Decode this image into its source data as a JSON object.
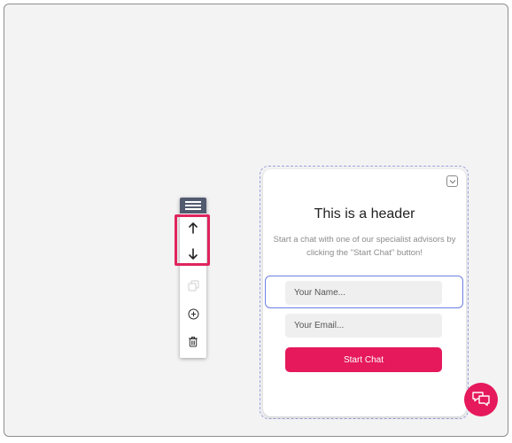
{
  "toolbar": {
    "icons": [
      "drag-handle-icon",
      "arrow-up-icon",
      "arrow-down-icon",
      "copy-icon",
      "add-circle-icon",
      "trash-icon"
    ]
  },
  "widget": {
    "header": "This is a header",
    "subtext": "Start a chat with one of our specialist advisors by clicking the \"Start Chat\" button!",
    "name_placeholder": "Your Name...",
    "email_placeholder": "Your Email...",
    "start_button": "Start Chat"
  },
  "colors": {
    "accent": "#e5195b",
    "handle": "#525a70",
    "focus_border": "#6c7fe0",
    "canvas_bg": "#f3f3f4"
  }
}
